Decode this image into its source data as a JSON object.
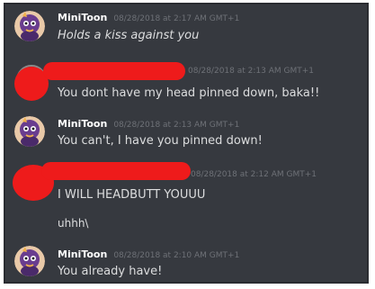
{
  "messages": [
    {
      "author": "MiniToon",
      "timestamp": "08/28/2018 at 2:17 AM GMT+1",
      "content": "Holds a kiss against you",
      "avatar_icon": "purple-cartoon-avatar-icon"
    },
    {
      "author": "",
      "timestamp": "08/28/2018 at 2:13 AM GMT+1",
      "content": "You dont have my head pinned down, baka!!",
      "avatar_icon": "redacted-avatar-icon"
    },
    {
      "author": "MiniToon",
      "timestamp": "08/28/2018 at 2:13 AM GMT+1",
      "content": "You can't, I have you pinned down!",
      "avatar_icon": "purple-cartoon-avatar-icon"
    },
    {
      "author": "",
      "timestamp": "08/28/2018 at 2:12 AM GMT+1",
      "content": "I WILL HEADBUTT YOUUU",
      "avatar_icon": "redacted-avatar-icon"
    },
    {
      "content": "uhhh\\"
    },
    {
      "author": "MiniToon",
      "timestamp": "08/28/2018 at 2:10 AM GMT+1",
      "content": "You already have!",
      "avatar_icon": "purple-cartoon-avatar-icon"
    }
  ],
  "colors": {
    "background": "#36393f",
    "author": "#ffffff",
    "timestamp": "#6e7177",
    "content": "#dcddde",
    "redaction": "#ee1b1b"
  }
}
